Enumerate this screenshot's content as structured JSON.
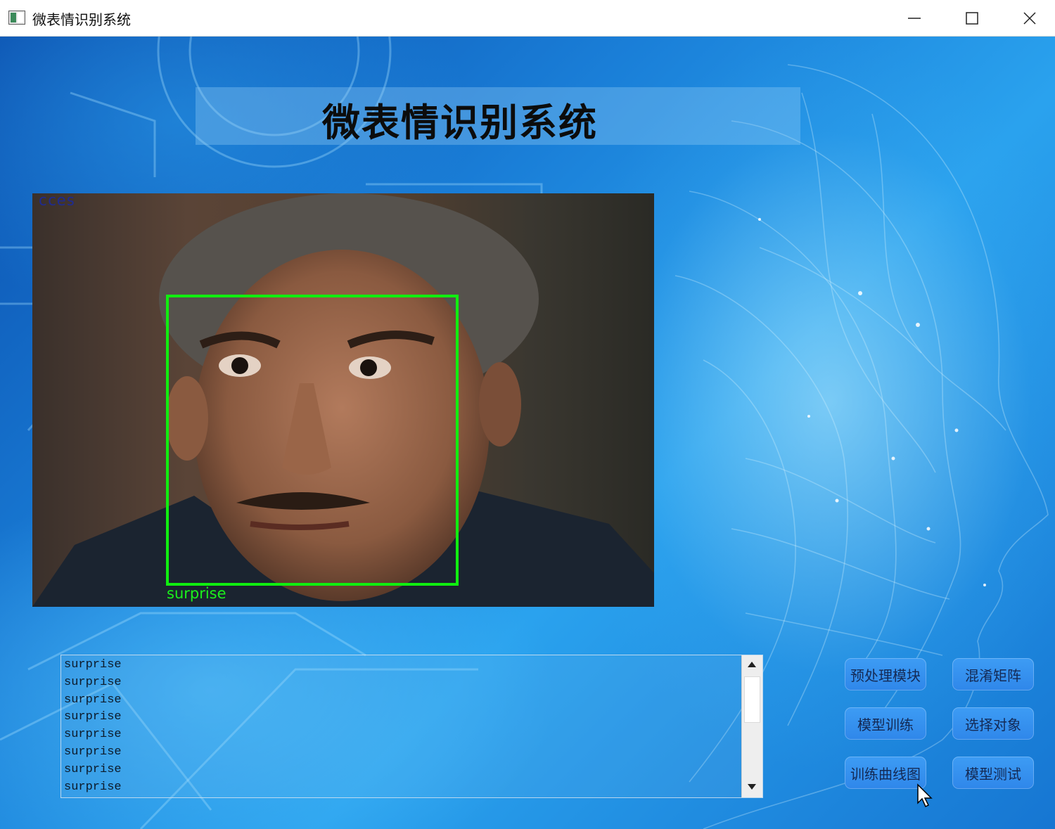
{
  "window": {
    "title": "微表情识别系统",
    "controls": {
      "minimize": "minimize",
      "maximize": "maximize",
      "close": "close"
    }
  },
  "header": {
    "heading": "微表情识别系统"
  },
  "video": {
    "overlay_text": "cces",
    "detection": {
      "label": "surprise",
      "box_color": "#10ee10"
    }
  },
  "log": {
    "lines": [
      "surprise",
      "surprise",
      "surprise",
      "surprise",
      "surprise",
      "surprise",
      "surprise",
      "surprise"
    ]
  },
  "buttons": {
    "preprocess": "预处理模块",
    "confusion_matrix": "混淆矩阵",
    "model_training": "模型训练",
    "select_object": "选择对象",
    "training_curve": "训练曲线图",
    "model_test": "模型测试"
  },
  "colors": {
    "accent": "#2f87ea",
    "background": "#1a7fd8",
    "detection": "#10ee10"
  },
  "icons": [
    "app-window-icon",
    "minimize-icon",
    "maximize-icon",
    "close-icon",
    "scroll-up-icon",
    "scroll-down-icon",
    "mouse-cursor-icon"
  ]
}
